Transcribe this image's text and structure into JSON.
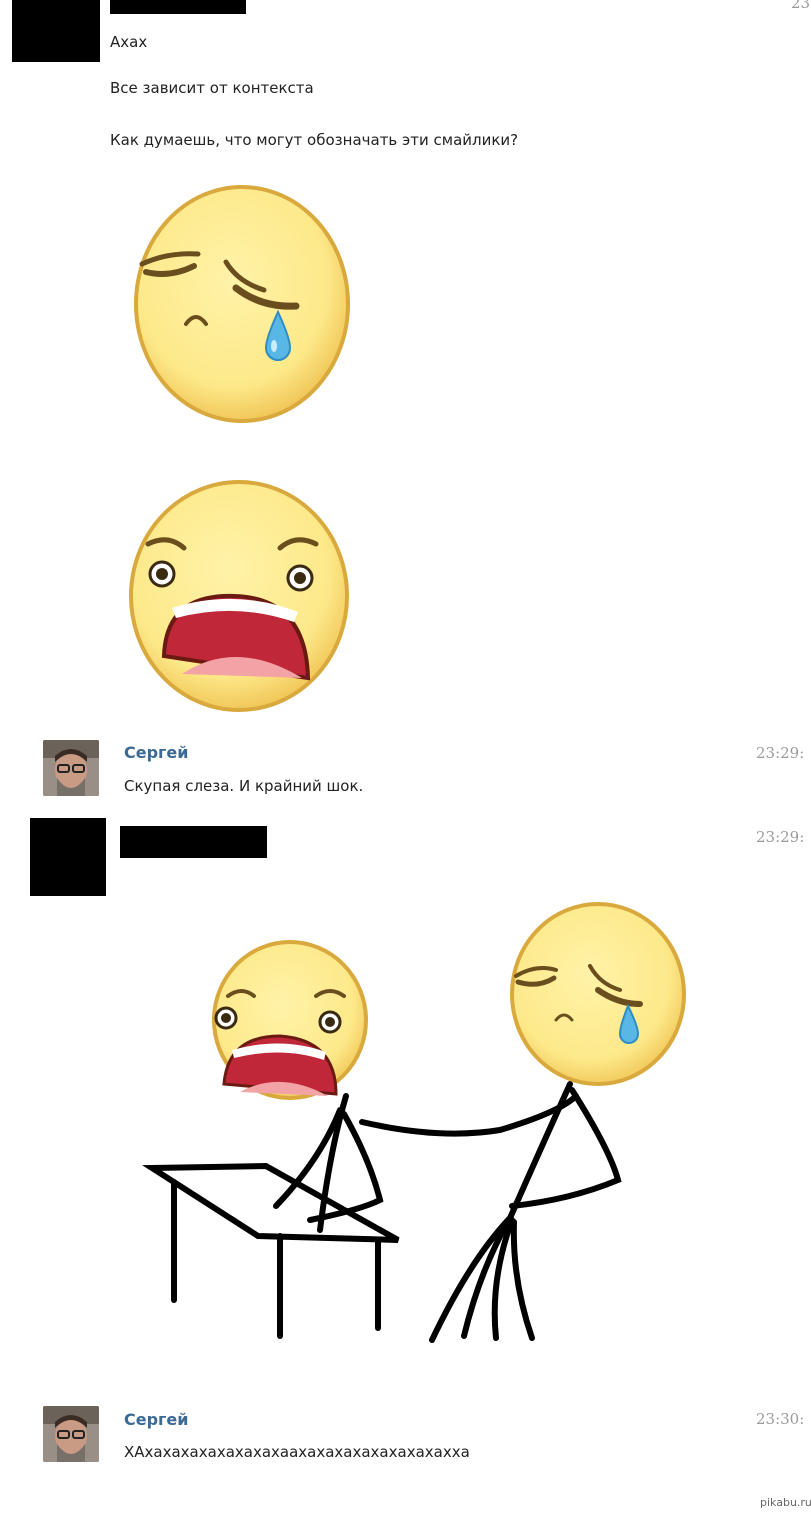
{
  "messages": [
    {
      "time": "23",
      "lines": [
        "Ахах",
        "Все зависит от контекста",
        "Как думаешь, что могут обозначать эти смайлики?"
      ]
    },
    {
      "author": "Сергей",
      "time": "23:29:",
      "text": "Скупая слеза. И крайний шок."
    },
    {
      "time": "23:29:"
    },
    {
      "author": "Сергей",
      "time": "23:30:",
      "text": "ХАхахахахахахахахаахахахахахахахахахха"
    }
  ],
  "icons": {
    "sad": "crying-smiley-icon",
    "shock": "shocked-smiley-icon"
  },
  "colors": {
    "smiley_fill": "#fde98a",
    "smiley_edge": "#e2b84d",
    "author": "#3a6a95",
    "time": "#9b9b9b",
    "tear": "#59b7e6"
  },
  "watermark": "pikabu.ru"
}
